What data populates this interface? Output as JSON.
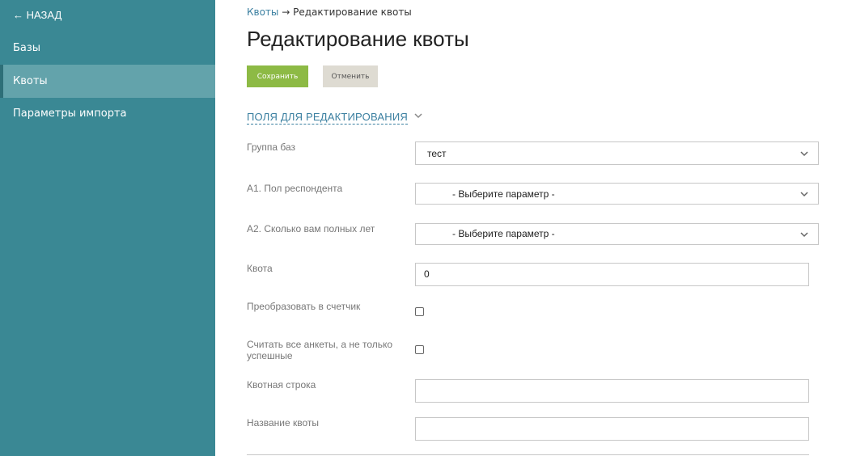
{
  "sidebar": {
    "back_label": "← НАЗАД",
    "items": [
      {
        "label": "Базы"
      },
      {
        "label": "Квоты"
      },
      {
        "label": "Параметры импорта"
      }
    ]
  },
  "breadcrumb": {
    "parent": "Квоты",
    "separator": "→",
    "current": "Редактирование квоты"
  },
  "page": {
    "title": "Редактирование квоты"
  },
  "toolbar": {
    "save_label": "Сохранить",
    "cancel_label": "Отменить"
  },
  "section": {
    "toggle_label": "ПОЛЯ ДЛЯ РЕДАКТИРОВАНИЯ",
    "toggle_icon": "chevron-down-icon"
  },
  "form": {
    "base_group": {
      "label": "Группа баз",
      "value": "тест"
    },
    "gender": {
      "label": "А1. Пол респондента",
      "value": "- Выберите параметр -"
    },
    "age": {
      "label": "А2. Сколько вам полных лет",
      "value": "- Выберите параметр -"
    },
    "quota": {
      "label": "Квота",
      "value": "0"
    },
    "convert_counter": {
      "label": "Преобразовать в счетчик",
      "checked": false
    },
    "count_all": {
      "label": "Считать все анкеты, а не только успешные",
      "checked": false
    },
    "quota_string": {
      "label": "Квотная строка",
      "value": ""
    },
    "quota_name": {
      "label": "Название квоты",
      "value": ""
    }
  },
  "colors": {
    "sidebar_bg": "#3a8894",
    "sidebar_active": "#63a3ab",
    "save_button": "#8dba45",
    "cancel_button": "#dedbd2",
    "link": "#3a7fa0"
  }
}
